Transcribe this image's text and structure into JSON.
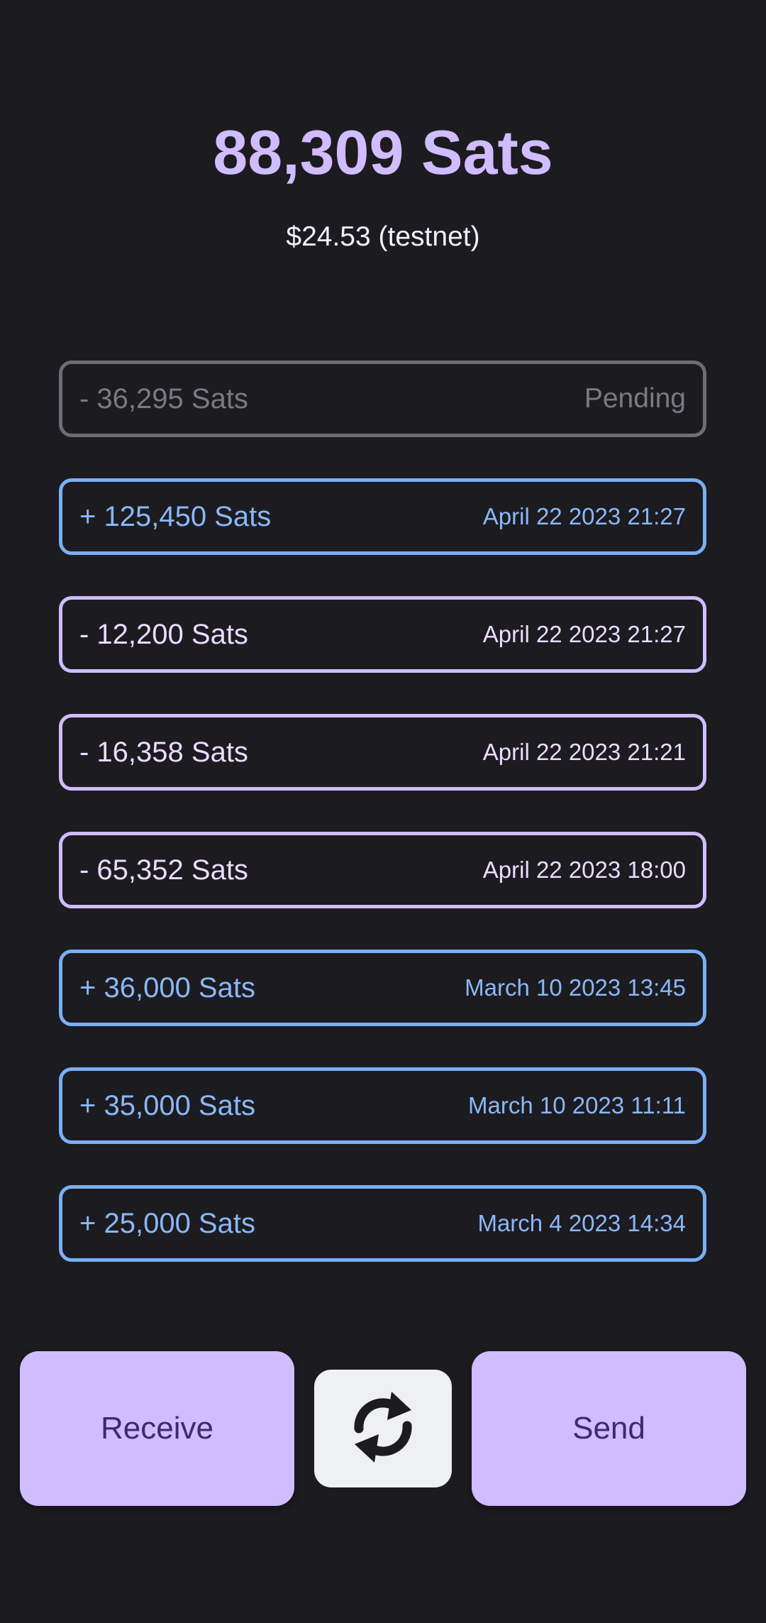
{
  "balance": {
    "sats": "88,309 Sats",
    "fiat": "$24.53 (testnet)"
  },
  "transactions": [
    {
      "amount": "- 36,295 Sats",
      "date": "Pending",
      "kind": "pending"
    },
    {
      "amount": "+ 125,450 Sats",
      "date": "April 22 2023 21:27",
      "kind": "incoming"
    },
    {
      "amount": "- 12,200 Sats",
      "date": "April 22 2023 21:27",
      "kind": "outgoing"
    },
    {
      "amount": "- 16,358 Sats",
      "date": "April 22 2023 21:21",
      "kind": "outgoing"
    },
    {
      "amount": "- 65,352 Sats",
      "date": "April 22 2023 18:00",
      "kind": "outgoing"
    },
    {
      "amount": "+ 36,000 Sats",
      "date": "March 10 2023 13:45",
      "kind": "incoming"
    },
    {
      "amount": "+ 35,000 Sats",
      "date": "March 10 2023 11:11",
      "kind": "incoming"
    },
    {
      "amount": "+ 25,000 Sats",
      "date": "March 4 2023 14:34",
      "kind": "incoming"
    }
  ],
  "actions": {
    "receive_label": "Receive",
    "sync_icon": "sync-icon",
    "send_label": "Send"
  },
  "colors": {
    "background": "#1c1b20",
    "accent": "#d0bcff",
    "incoming": "#7aaff5",
    "pending": "#6e6d73"
  }
}
